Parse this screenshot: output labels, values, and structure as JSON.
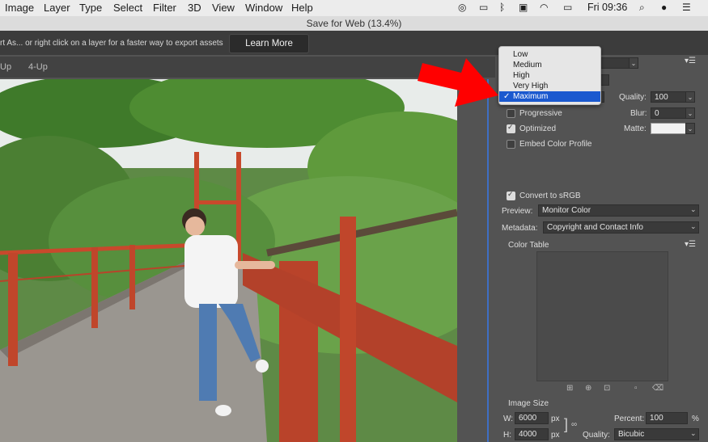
{
  "menubar": {
    "items": [
      "Image",
      "Layer",
      "Type",
      "Select",
      "Filter",
      "3D",
      "View",
      "Window",
      "Help"
    ],
    "clock": "Fri 09:36"
  },
  "window": {
    "title": "Save for Web (13.4%)"
  },
  "infobar": {
    "text": "rt As... or right click on a layer for a faster way to export assets",
    "learn_more": "Learn More"
  },
  "tabs": [
    "Up",
    "4-Up"
  ],
  "dropdown": {
    "options": [
      "Low",
      "Medium",
      "High",
      "Very High",
      "Maximum"
    ],
    "selected": "Maximum"
  },
  "settings": {
    "quality_label": "Quality:",
    "quality_value": "100",
    "progressive": "Progressive",
    "progressive_checked": false,
    "blur_label": "Blur:",
    "blur_value": "0",
    "optimized": "Optimized",
    "optimized_checked": true,
    "matte_label": "Matte:",
    "embed_profile": "Embed Color Profile",
    "embed_checked": false,
    "convert_srgb": "Convert to sRGB",
    "convert_checked": true,
    "preview_label": "Preview:",
    "preview_value": "Monitor Color",
    "metadata_label": "Metadata:",
    "metadata_value": "Copyright and Contact Info",
    "color_table": "Color Table"
  },
  "image_size": {
    "title": "Image Size",
    "w_label": "W:",
    "w_value": "6000",
    "h_label": "H:",
    "h_value": "4000",
    "unit": "px",
    "percent_label": "Percent:",
    "percent_value": "100",
    "percent_unit": "%",
    "quality_label": "Quality:",
    "quality_value": "Bicubic"
  },
  "colors": {
    "selection": "#1b59cf",
    "arrow": "#ff0000",
    "divider": "#3f6fc4"
  }
}
